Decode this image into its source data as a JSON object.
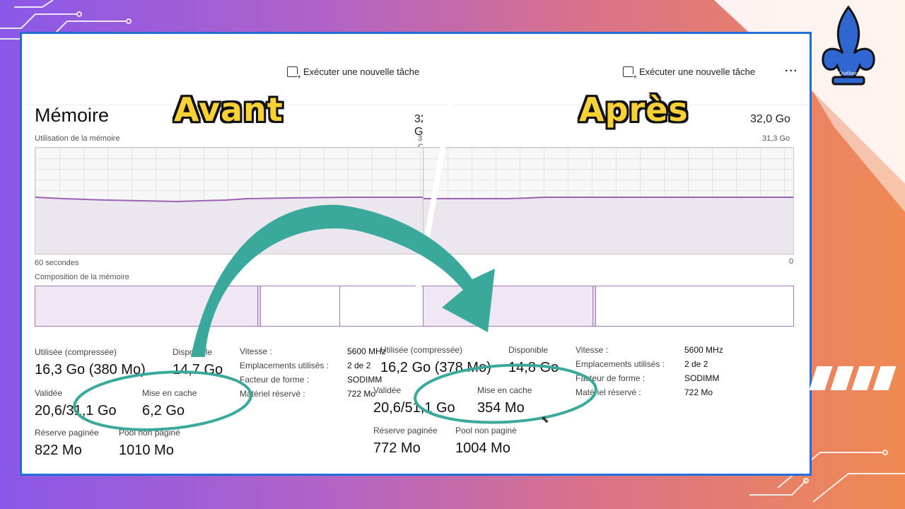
{
  "toolbar": {
    "run_task_label": "Exécuter une nouvelle tâche",
    "more_label": "···"
  },
  "labels": {
    "before": "Avant",
    "after": "Après"
  },
  "logo_text": "Québec Test",
  "memory": {
    "title": "Mémoire",
    "total": "32,0 Go",
    "usage_label": "Utilisation de la mémoire",
    "graph_max": "31,3 Go",
    "graph_max_before": "31,3 C",
    "graph_time": "60 secondes",
    "graph_zero": "0",
    "composition_label": "Composition de la mémoire"
  },
  "before": {
    "used_label": "Utilisée (compressée)",
    "used_value": "16,3 Go (380 Mo)",
    "available_label": "Disponible",
    "available_value": "14,7 Go",
    "committed_label": "Validée",
    "committed_value": "20,6/31,1 Go",
    "cached_label": "Mise en cache",
    "cached_value": "6,2 Go",
    "paged_label": "Réserve paginée",
    "paged_value": "822 Mo",
    "nonpaged_label": "Pool non paginé",
    "nonpaged_value": "1010 Mo",
    "specs": [
      {
        "label": "Vitesse :",
        "value": "5600 MHz"
      },
      {
        "label": "Emplacements utilisés :",
        "value": "2 de 2"
      },
      {
        "label": "Facteur de forme :",
        "value": "SODIMM"
      },
      {
        "label": "Matériel réservé :",
        "value": "722 Mo"
      }
    ]
  },
  "after": {
    "used_label": "Utilisée (compressée)",
    "used_value": "16,2 Go (378 Mo)",
    "available_label": "Disponible",
    "available_value": "14,8 Go",
    "committed_label": "Validée",
    "committed_value": "20,6/51,1 Go",
    "cached_label": "Mise en cache",
    "cached_value": "354 Mo",
    "paged_label": "Réserve paginée",
    "paged_value": "772 Mo",
    "nonpaged_label": "Pool non paginé",
    "nonpaged_value": "1004 Mo",
    "specs": [
      {
        "label": "Vitesse :",
        "value": "5600 MHz"
      },
      {
        "label": "Emplacements utilisés :",
        "value": "2 de 2"
      },
      {
        "label": "Facteur de forme :",
        "value": "SODIMM"
      },
      {
        "label": "Matériel réservé :",
        "value": "722 Mo"
      }
    ]
  },
  "colors": {
    "accent_teal": "#3aa99b",
    "frame_blue": "#1f6fd6",
    "badge_yellow": "#f7d136",
    "graph_line": "#9b62b5"
  }
}
